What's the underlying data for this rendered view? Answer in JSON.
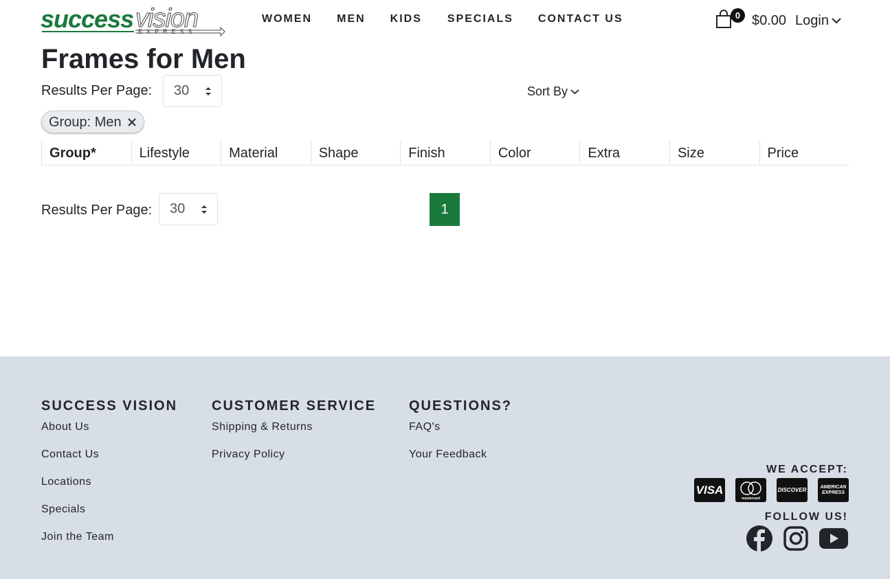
{
  "header": {
    "logo": {
      "primary": "success",
      "secondary": "vision",
      "tagline": "EXPRESS"
    },
    "nav": [
      "WOMEN",
      "MEN",
      "KIDS",
      "SPECIALS",
      "CONTACT US"
    ],
    "cart_count": "0",
    "cart_total": "$0.00",
    "login_label": "Login"
  },
  "main": {
    "title": "Frames for Men",
    "results_per_page_label": "Results Per Page:",
    "results_per_page_value": "30",
    "sort_label": "Sort By",
    "active_filter": "Group: Men",
    "filters": [
      "Group*",
      "Lifestyle",
      "Material",
      "Shape",
      "Finish",
      "Color",
      "Extra",
      "Size",
      "Price"
    ],
    "pagination": {
      "current_page": "1"
    }
  },
  "footer": {
    "columns": [
      {
        "heading": "SUCCESS VISION",
        "links": [
          "About Us",
          "Contact Us",
          "Locations",
          "Specials",
          "Join the Team"
        ]
      },
      {
        "heading": "CUSTOMER SERVICE",
        "links": [
          "Shipping & Returns",
          "Privacy Policy"
        ]
      },
      {
        "heading": "QUESTIONS?",
        "links": [
          "FAQ's",
          "Your Feedback"
        ]
      }
    ],
    "we_accept_label": "WE ACCEPT:",
    "cards": [
      "VISA",
      "mastercard",
      "DISCOVER",
      "AMERICAN EXPRESS"
    ],
    "follow_label": "FOLLOW US!",
    "social": [
      "facebook-icon",
      "instagram-icon",
      "youtube-icon"
    ]
  },
  "colors": {
    "brand_green": "#1a7a3c",
    "footer_bg": "#d8dee6",
    "text": "#212529"
  }
}
